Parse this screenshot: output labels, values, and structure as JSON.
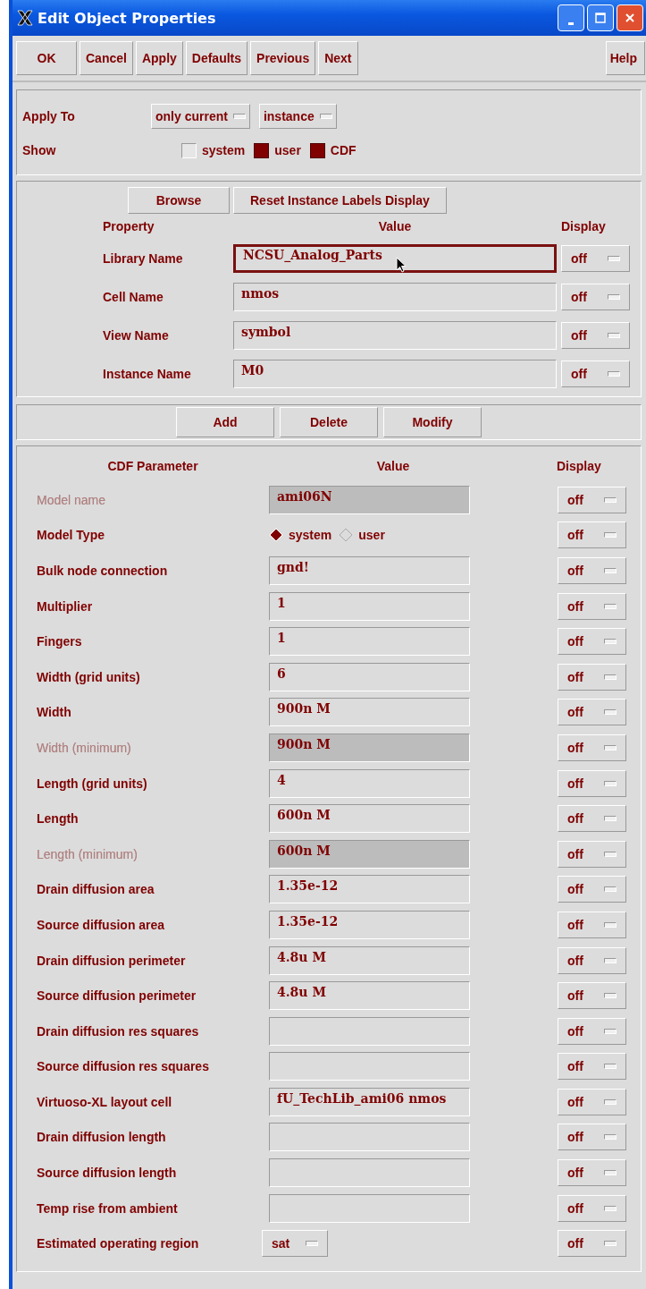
{
  "window": {
    "title": "Edit Object Properties"
  },
  "toolbar": {
    "buttons": [
      "OK",
      "Cancel",
      "Apply",
      "Defaults",
      "Previous",
      "Next"
    ],
    "help": "Help"
  },
  "apply_to": {
    "label": "Apply To",
    "options": [
      "only current",
      "instance"
    ]
  },
  "show": {
    "label": "Show",
    "checkboxes": [
      {
        "label": "system",
        "checked": false
      },
      {
        "label": "user",
        "checked": true
      },
      {
        "label": "CDF",
        "checked": true
      }
    ]
  },
  "property_section": {
    "buttons": [
      "Browse",
      "Reset Instance Labels Display"
    ],
    "columns": [
      "Property",
      "Value",
      "Display"
    ],
    "rows": [
      {
        "label": "Library Name",
        "value": "NCSU_Analog_Parts",
        "focused": true,
        "display": "off"
      },
      {
        "label": "Cell Name",
        "value": "nmos",
        "focused": false,
        "display": "off"
      },
      {
        "label": "View Name",
        "value": "symbol",
        "focused": false,
        "display": "off"
      },
      {
        "label": "Instance Name",
        "value": "M0",
        "focused": false,
        "display": "off"
      }
    ]
  },
  "edit_buttons": [
    "Add",
    "Delete",
    "Modify"
  ],
  "cdf": {
    "columns": [
      "CDF Parameter",
      "Value",
      "Display"
    ],
    "rows": [
      {
        "kind": "field",
        "label": "Model name",
        "value": "ami06N",
        "disabled": true,
        "display": "off"
      },
      {
        "kind": "radio",
        "label": "Model Type",
        "options": [
          {
            "label": "system",
            "selected": true
          },
          {
            "label": "user",
            "selected": false
          }
        ],
        "disabled": false,
        "display": "off"
      },
      {
        "kind": "field",
        "label": "Bulk node connection",
        "value": "gnd!",
        "disabled": false,
        "display": "off"
      },
      {
        "kind": "field",
        "label": "Multiplier",
        "value": "1",
        "disabled": false,
        "display": "off"
      },
      {
        "kind": "field",
        "label": "Fingers",
        "value": "1",
        "disabled": false,
        "display": "off"
      },
      {
        "kind": "field",
        "label": "Width (grid units)",
        "value": "6",
        "disabled": false,
        "display": "off"
      },
      {
        "kind": "field",
        "label": "Width",
        "value": "900n M",
        "disabled": false,
        "display": "off"
      },
      {
        "kind": "field",
        "label": "Width (minimum)",
        "value": "900n M",
        "disabled": true,
        "display": "off"
      },
      {
        "kind": "field",
        "label": "Length (grid units)",
        "value": "4",
        "disabled": false,
        "display": "off"
      },
      {
        "kind": "field",
        "label": "Length",
        "value": "600n M",
        "disabled": false,
        "display": "off"
      },
      {
        "kind": "field",
        "label": "Length (minimum)",
        "value": "600n M",
        "disabled": true,
        "display": "off"
      },
      {
        "kind": "field",
        "label": "Drain diffusion area",
        "value": "1.35e-12",
        "disabled": false,
        "display": "off"
      },
      {
        "kind": "field",
        "label": "Source diffusion area",
        "value": "1.35e-12",
        "disabled": false,
        "display": "off"
      },
      {
        "kind": "field",
        "label": "Drain diffusion perimeter",
        "value": "4.8u M",
        "disabled": false,
        "display": "off"
      },
      {
        "kind": "field",
        "label": "Source diffusion perimeter",
        "value": "4.8u M",
        "disabled": false,
        "display": "off"
      },
      {
        "kind": "field",
        "label": "Drain diffusion res squares",
        "disabled": false,
        "display": "off"
      },
      {
        "kind": "field",
        "label": "Source diffusion res squares",
        "disabled": false,
        "display": "off"
      },
      {
        "kind": "field",
        "label": "Virtuoso-XL layout cell",
        "value": "fU_TechLib_ami06 nmos",
        "disabled": false,
        "display": "off"
      },
      {
        "kind": "field",
        "label": "Drain diffusion length",
        "disabled": false,
        "display": "off"
      },
      {
        "kind": "field",
        "label": "Source diffusion length",
        "disabled": false,
        "display": "off"
      },
      {
        "kind": "field",
        "label": "Temp rise from ambient",
        "disabled": false,
        "display": "off"
      },
      {
        "kind": "cycle",
        "label": "Estimated operating region",
        "value": "sat",
        "disabled": false,
        "display": "off"
      }
    ]
  }
}
